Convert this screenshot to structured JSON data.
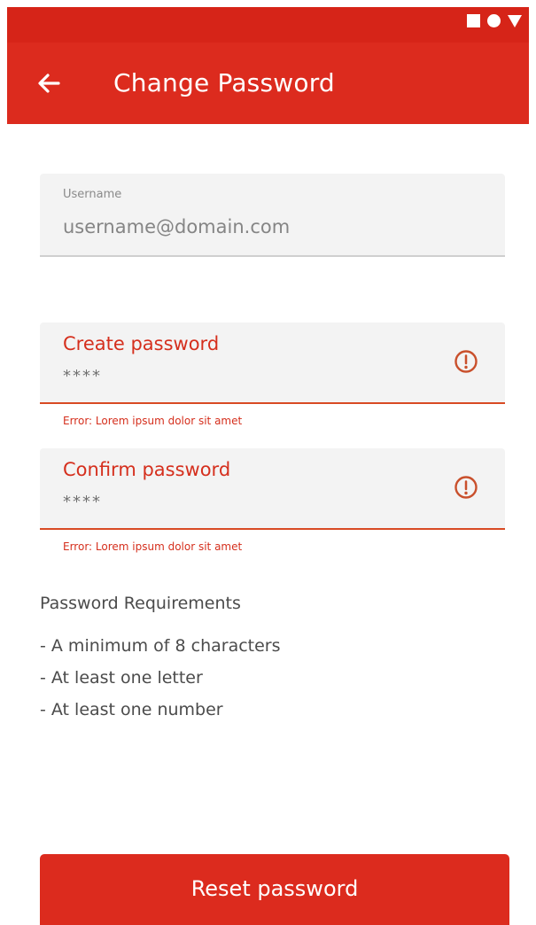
{
  "app_bar": {
    "title": "Change Password"
  },
  "status_bar": {
    "icons": [
      "square-icon",
      "circle-icon",
      "triangle-icon"
    ]
  },
  "form": {
    "username": {
      "label": "Username",
      "value": "username@domain.com"
    },
    "create_password": {
      "label": "Create password",
      "value": "****",
      "error": "Error: Lorem ipsum dolor sit amet"
    },
    "confirm_password": {
      "label": "Confirm password",
      "value": "****",
      "error": "Error: Lorem ipsum dolor sit amet"
    }
  },
  "requirements": {
    "title": "Password Requirements",
    "items": [
      "- A minimum of 8 characters",
      "- At least one letter",
      "- At least one number"
    ]
  },
  "actions": {
    "reset_label": "Reset password"
  },
  "colors": {
    "primary": "#dc2b1e",
    "status_bar": "#d62418",
    "error": "#d52f1d",
    "field_bg": "#f3f3f3"
  }
}
